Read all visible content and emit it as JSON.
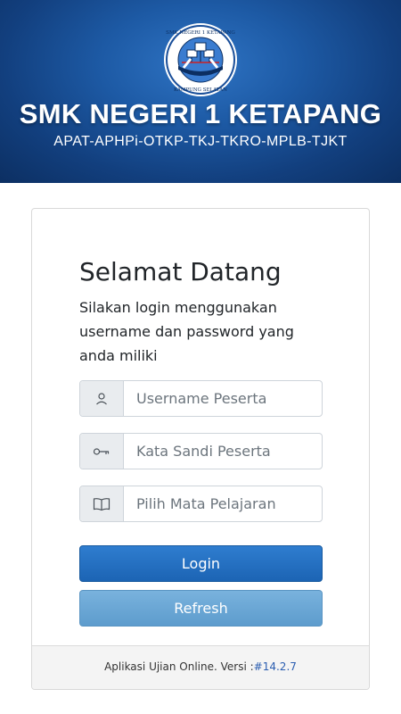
{
  "header": {
    "school_name": "SMK NEGERI 1 KETAPANG",
    "majors": "APAT-APHPi-OTKP-TKJ-TKRO-MPLB-TJKT",
    "logo_top_text": "SMK NEGERI 1 KETAPANG",
    "logo_bottom_text": "KAMPUNG SELATAN"
  },
  "login": {
    "title": "Selamat Datang",
    "instructions": "Silakan login menggunakan username dan password yang anda miliki",
    "username_placeholder": "Username Peserta",
    "password_placeholder": "Kata Sandi Peserta",
    "subject_placeholder": "Pilih Mata Pelajaran",
    "login_label": "Login",
    "refresh_label": "Refresh",
    "icons": {
      "username": "user-icon",
      "password": "key-icon",
      "subject": "book-icon"
    }
  },
  "footer": {
    "app_text": "Aplikasi Ujian Online. Versi :",
    "version": "#14.2.7"
  },
  "colors": {
    "header": "#1d5aa5",
    "login_button": "#1c64b4",
    "refresh_button": "#5d9ccd",
    "version_link": "#2a5db0"
  }
}
